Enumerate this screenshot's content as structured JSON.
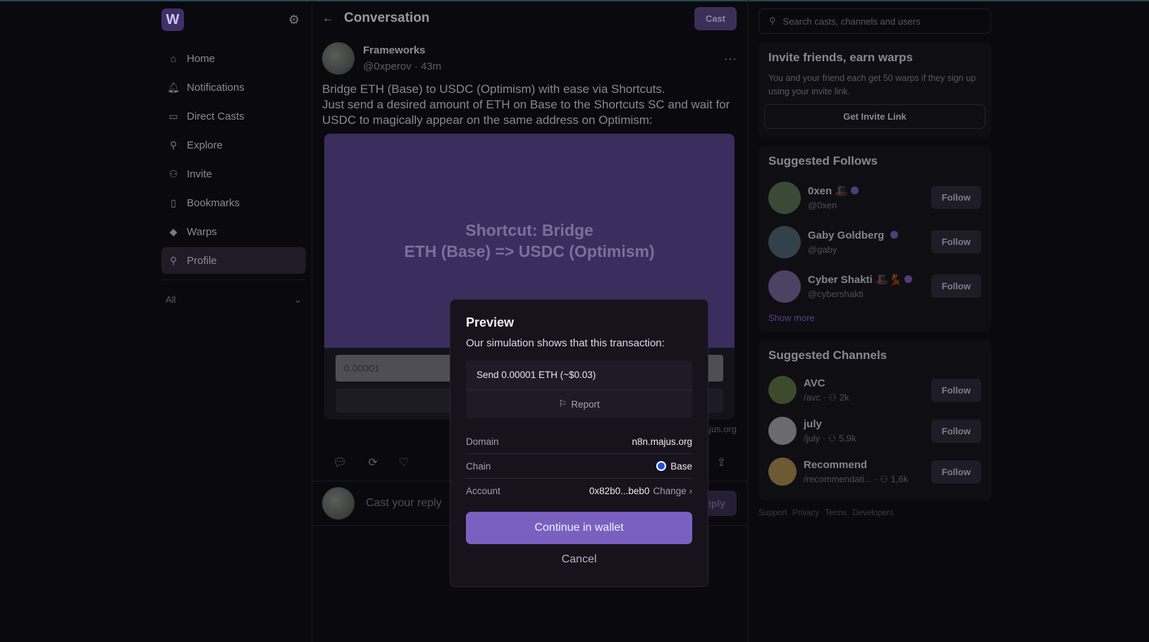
{
  "app": {
    "logo": "W"
  },
  "sidebar": {
    "items": [
      {
        "label": "Home",
        "icon": "home-icon",
        "glyph": "⌂"
      },
      {
        "label": "Notifications",
        "icon": "bell-icon",
        "glyph": "🔔︎"
      },
      {
        "label": "Direct Casts",
        "icon": "chat-icon",
        "glyph": "▭"
      },
      {
        "label": "Explore",
        "icon": "search-icon",
        "glyph": "⚲"
      },
      {
        "label": "Invite",
        "icon": "users-icon",
        "glyph": "⚇"
      },
      {
        "label": "Bookmarks",
        "icon": "bookmark-icon",
        "glyph": "▯"
      },
      {
        "label": "Warps",
        "icon": "diamond-icon",
        "glyph": "◆"
      },
      {
        "label": "Profile",
        "icon": "user-icon",
        "glyph": "⚲"
      }
    ],
    "active": "Profile",
    "filter": "All"
  },
  "header": {
    "title": "Conversation",
    "cast_label": "Cast"
  },
  "post": {
    "author": "Frameworks",
    "handle": "@0xperov",
    "time": "43m",
    "text_lines": [
      "Bridge ETH (Base) to USDC (Optimism) with ease via Shortcuts.",
      "Just send a desired amount of ETH on Base to the Shortcuts SC and wait for USDC to magically appear on the same address on Optimism:"
    ],
    "frame": {
      "title_line1": "Shortcut: Bridge",
      "title_line2": "ETH (Base) => USDC (Optimism)",
      "input_value": "0.00001",
      "domain": "n8n.majus.org"
    }
  },
  "reply": {
    "placeholder": "Cast your reply",
    "button": "Reply"
  },
  "search": {
    "placeholder": "Search casts, channels and users"
  },
  "invite": {
    "title": "Invite friends, earn warps",
    "text": "You and your friend each get 50 warps if they sign up using your invite link.",
    "button": "Get Invite Link"
  },
  "suggested_follows": {
    "title": "Suggested Follows",
    "users": [
      {
        "name": "0xen",
        "emoji": "🎩",
        "handle": "@0xen",
        "color": "#3a4a36"
      },
      {
        "name": "Gaby Goldberg",
        "emoji": "",
        "handle": "@gaby",
        "color": "#32414a"
      },
      {
        "name": "Cyber Shakti",
        "emoji": "🎩💃",
        "handle": "@cybershakti",
        "color": "#4b4364"
      }
    ],
    "follow_label": "Follow",
    "show_more": "Show more"
  },
  "suggested_channels": {
    "title": "Suggested Channels",
    "channels": [
      {
        "name": "AVC",
        "path": "/avc",
        "members": "2k",
        "color": "#3e4a2c"
      },
      {
        "name": "july",
        "path": "/july",
        "members": "5,9k",
        "color": "#6b6a6f"
      },
      {
        "name": "Recommend",
        "path": "/recommendati...",
        "members": "1,6k",
        "color": "#6b5a34"
      }
    ]
  },
  "footer": [
    "Support",
    "Privacy",
    "Terms",
    "Developers"
  ],
  "modal": {
    "title": "Preview",
    "subtitle": "Our simulation shows that this transaction:",
    "simulation": "Send 0.00001 ETH (~$0.03)",
    "report": "Report",
    "domain_label": "Domain",
    "domain": "n8n.majus.org",
    "chain_label": "Chain",
    "chain": "Base",
    "chain_color": "#1d4fe0",
    "account_label": "Account",
    "account": "0x82b0...beb0",
    "change": "Change ›",
    "continue": "Continue in wallet",
    "cancel": "Cancel",
    "accent": "#7a61c0"
  }
}
